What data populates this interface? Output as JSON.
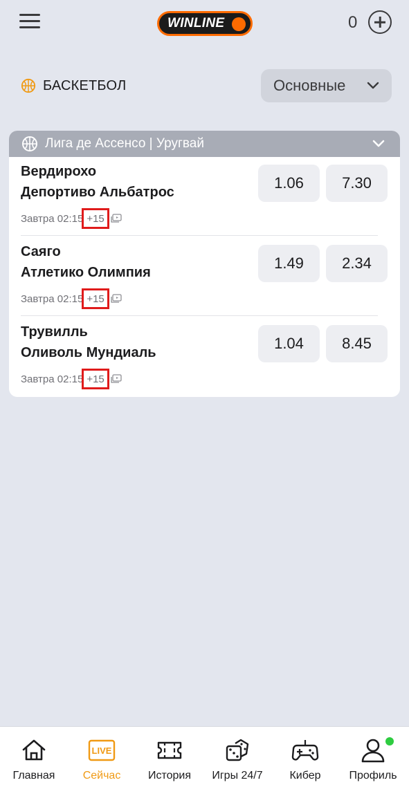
{
  "header": {
    "logo_text": "WINLINE",
    "balance": "0"
  },
  "sport": {
    "title": "БАСКЕТБОЛ",
    "filter_label": "Основные"
  },
  "league": {
    "name": "Лига де Ассенсо | Уругвай",
    "events": [
      {
        "team1": "Вердирохо",
        "team2": "Депортиво Альбатрос",
        "time": "Завтра 02:15",
        "more": "+15",
        "odd1": "1.06",
        "odd2": "7.30"
      },
      {
        "team1": "Саяго",
        "team2": "Атлетико Олимпия",
        "time": "Завтра 02:15",
        "more": "+15",
        "odd1": "1.49",
        "odd2": "2.34"
      },
      {
        "team1": "Трувилль",
        "team2": "Оливоль Мундиаль",
        "time": "Завтра 02:15",
        "more": "+15",
        "odd1": "1.04",
        "odd2": "8.45"
      }
    ]
  },
  "nav": {
    "items": [
      {
        "label": "Главная",
        "icon": "home-icon"
      },
      {
        "label": "Сейчас",
        "icon": "live-icon",
        "badge": "LIVE"
      },
      {
        "label": "История",
        "icon": "ticket-icon"
      },
      {
        "label": "Игры 24/7",
        "icon": "dice-icon"
      },
      {
        "label": "Кибер",
        "icon": "gamepad-icon"
      },
      {
        "label": "Профиль",
        "icon": "user-icon"
      }
    ]
  },
  "colors": {
    "accent": "#ff6b00",
    "active_nav": "#f09a14",
    "online": "#2ecc40",
    "highlight_box": "#e01b1b"
  }
}
